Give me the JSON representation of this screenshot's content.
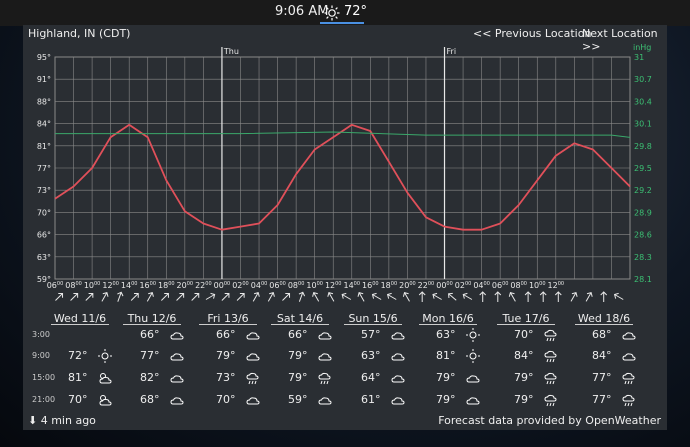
{
  "topbar": {
    "time": "9:06 AM",
    "temp": "72°",
    "icon": "sun-icon"
  },
  "location": "Highland, IN (CDT)",
  "nav": {
    "prev": "<< Previous Location",
    "next": "Next Location >>"
  },
  "chart_data": {
    "type": "line",
    "temp_axis": {
      "ticks": [
        "59°",
        "63°",
        "66°",
        "70°",
        "73°",
        "77°",
        "81°",
        "84°",
        "88°",
        "91°",
        "95°"
      ],
      "ylim": [
        59,
        95
      ]
    },
    "pressure_axis": {
      "unit": "inHg",
      "ticks": [
        "28.1",
        "28.3",
        "28.6",
        "28.9",
        "29.2",
        "29.5",
        "29.8",
        "30.1",
        "30.4",
        "30.7",
        "31"
      ],
      "ylim": [
        28.1,
        31
      ]
    },
    "day_markers": [
      "Thu",
      "Fri"
    ],
    "x_ticks": [
      "06",
      "08",
      "10",
      "12",
      "14",
      "16",
      "18",
      "20",
      "22",
      "00",
      "02",
      "04",
      "06",
      "08",
      "10",
      "12",
      "14",
      "16",
      "18",
      "20",
      "22",
      "00",
      "02",
      "04",
      "06",
      "08",
      "10",
      "12"
    ],
    "x_tick_sup": "00",
    "series": [
      {
        "hours": [
          0,
          2,
          4,
          6,
          8,
          10,
          12,
          14,
          16,
          18,
          20,
          22,
          24,
          26,
          28,
          30,
          32,
          34,
          36,
          38,
          40,
          42,
          44,
          46,
          48,
          50,
          52,
          54,
          56,
          58,
          60,
          62
        ],
        "values": [
          72,
          74,
          77,
          82,
          84,
          82,
          75,
          70,
          68,
          67,
          67.5,
          68,
          71,
          76,
          80,
          82,
          84,
          83,
          78,
          73,
          69,
          67.5,
          67,
          67,
          68,
          71,
          75,
          79,
          81,
          80,
          77,
          74
        ]
      },
      {
        "hours": [
          0,
          10,
          20,
          30,
          40,
          50,
          60,
          62
        ],
        "values": [
          30.0,
          30.0,
          30.0,
          30.02,
          29.98,
          29.98,
          29.98,
          29.95
        ]
      }
    ],
    "wind_dirs": [
      45,
      45,
      45,
      30,
      20,
      45,
      30,
      45,
      45,
      45,
      60,
      45,
      45,
      30,
      30,
      45,
      20,
      330,
      330,
      300,
      330,
      300,
      300,
      330,
      0,
      300,
      310,
      300,
      0,
      0,
      330,
      0,
      0,
      0,
      30,
      30,
      0,
      300
    ]
  },
  "forecast": {
    "days": [
      "Wed 11/6",
      "Thu 12/6",
      "Fri 13/6",
      "Sat 14/6",
      "Sun 15/6",
      "Mon 16/6",
      "Tue 17/6",
      "Wed 18/6"
    ],
    "times": [
      "3:00",
      "9:00",
      "15:00",
      "21:00"
    ],
    "rows": [
      [
        "",
        "66°",
        "66°",
        "66°",
        "57°",
        "63°",
        "70°",
        "68°"
      ],
      [
        "72°",
        "77°",
        "79°",
        "79°",
        "63°",
        "81°",
        "84°",
        "84°"
      ],
      [
        "81°",
        "82°",
        "73°",
        "79°",
        "64°",
        "79°",
        "79°",
        "77°"
      ],
      [
        "70°",
        "68°",
        "70°",
        "59°",
        "61°",
        "79°",
        "79°",
        "77°"
      ]
    ],
    "icons": [
      [
        "",
        "cloud-icon",
        "cloud-icon",
        "cloud-icon",
        "cloud-icon",
        "sun-icon",
        "rain-icon",
        "cloud-icon"
      ],
      [
        "sun-icon",
        "cloud-icon",
        "cloud-icon",
        "cloud-icon",
        "cloud-icon",
        "sun-icon",
        "rain-icon",
        "cloud-icon"
      ],
      [
        "partly-sunny-icon",
        "cloud-icon",
        "rain-icon",
        "rain-icon",
        "cloud-icon",
        "cloud-icon",
        "rain-icon",
        "rain-icon"
      ],
      [
        "partly-sunny-icon",
        "cloud-icon",
        "cloud-icon",
        "cloud-icon",
        "cloud-icon",
        "cloud-icon",
        "rain-icon",
        "rain-icon"
      ]
    ]
  },
  "footer": {
    "updated": "⬇ 4 min ago",
    "credit": "Forecast data provided by OpenWeather"
  },
  "colors": {
    "temp_line": "#e0505a",
    "pressure_line": "#3aa86a",
    "grid": "#8a8a8a",
    "pressure_tick": "#3cbf73",
    "marker_line": "#e8e8e8"
  }
}
